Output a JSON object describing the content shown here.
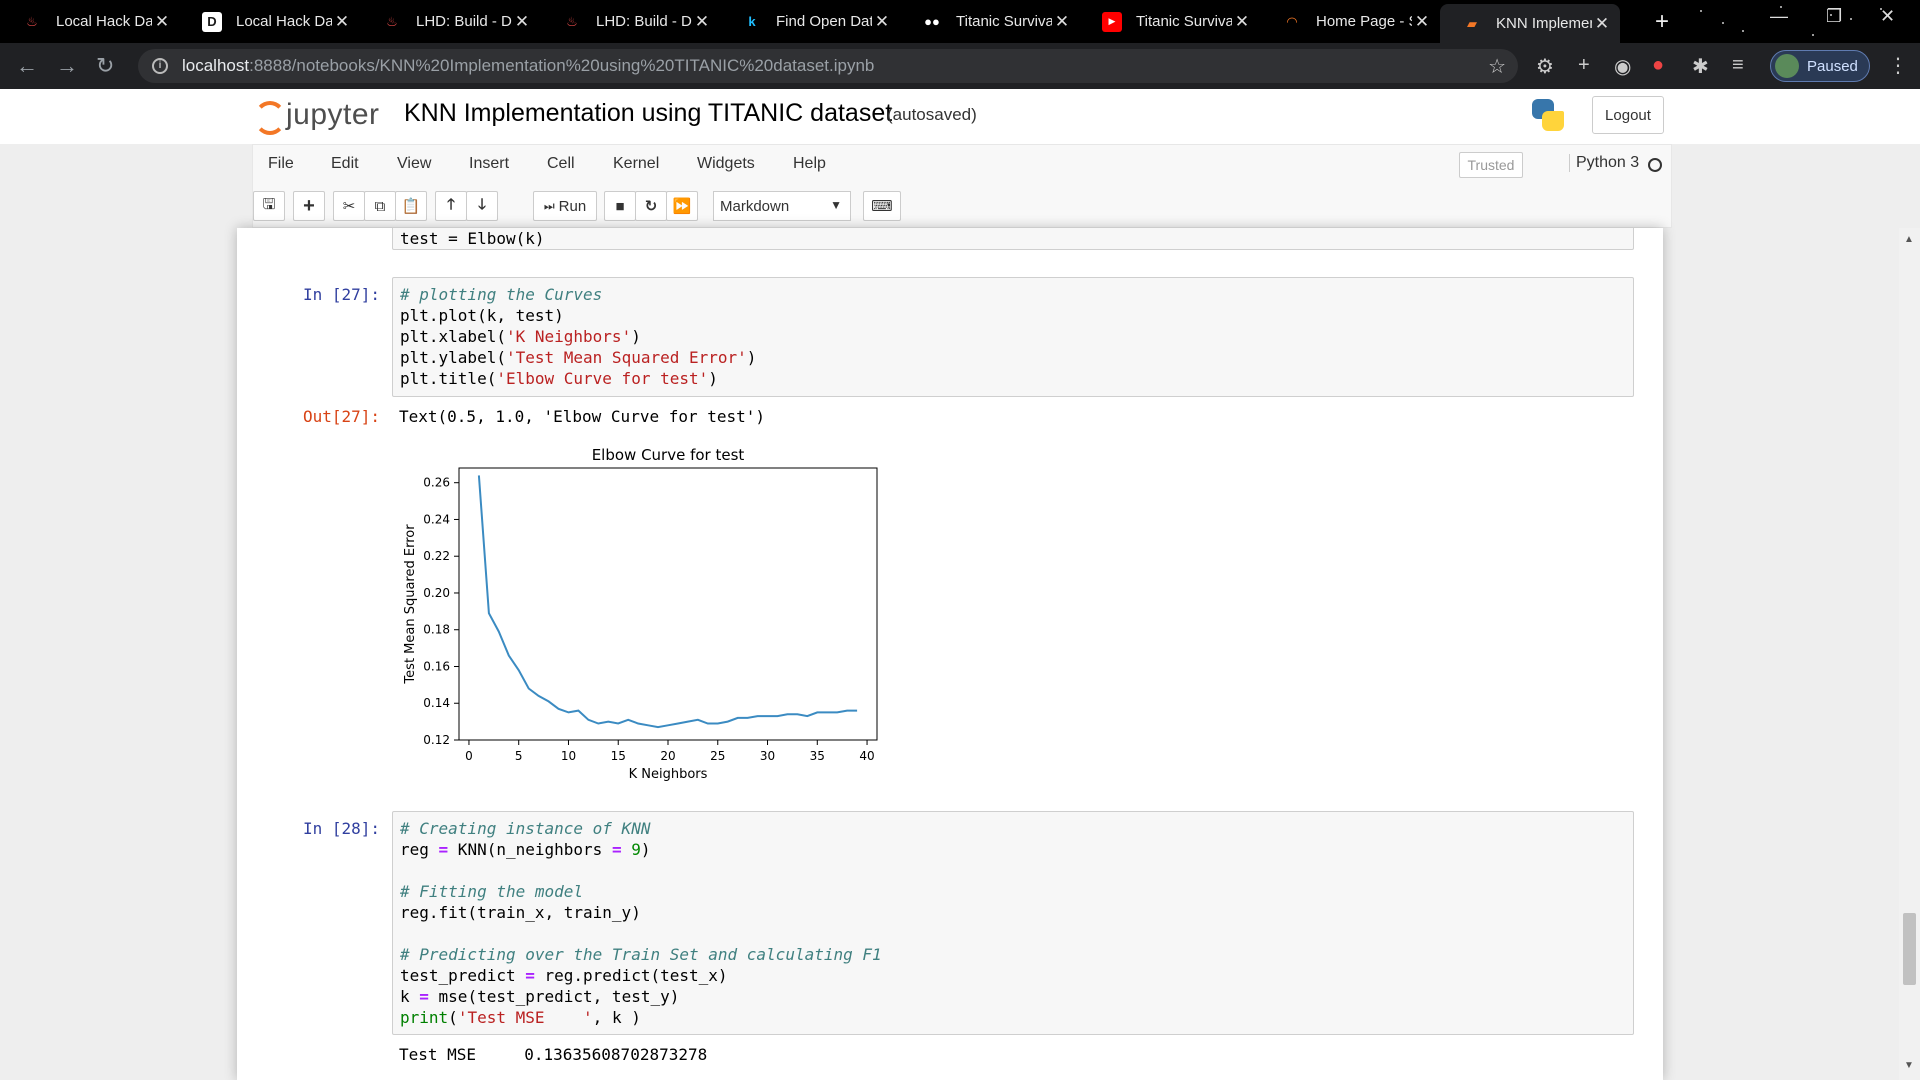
{
  "browser": {
    "tabs": [
      {
        "label": "Local Hack Day",
        "favicon": "lhd-flame-icon",
        "color": "#e34a4a"
      },
      {
        "label": "Local Hack Day",
        "favicon": "devpost-d-icon",
        "color": "#1a1a1a"
      },
      {
        "label": "LHD: Build - Da",
        "favicon": "lhd-flame-icon",
        "color": "#e34a4a"
      },
      {
        "label": "LHD: Build - Da",
        "favicon": "lhd-flame-icon",
        "color": "#e34a4a"
      },
      {
        "label": "Find Open Data",
        "favicon": "kaggle-k-icon",
        "color": "#20beff"
      },
      {
        "label": "Titanic Survival",
        "favicon": "medium-icon",
        "color": "#ffffff"
      },
      {
        "label": "Titanic Survival",
        "favicon": "youtube-icon",
        "color": "#ff0000"
      },
      {
        "label": "Home Page - S",
        "favicon": "jupyter-icon",
        "color": "#f37726"
      },
      {
        "label": "KNN Implemen",
        "favicon": "notebook-icon",
        "color": "#f37726"
      }
    ],
    "url_host": "localhost",
    "url_path": ":8888/notebooks/KNN%20Implementation%20using%20TITANIC%20dataset.ipynb",
    "profile_label": "Paused"
  },
  "jupyter": {
    "logo_text": "jupyter",
    "notebook_title": "KNN Implementation using TITANIC dataset",
    "autosave": "(autosaved)",
    "logout": "Logout",
    "menu": [
      "File",
      "Edit",
      "View",
      "Insert",
      "Cell",
      "Kernel",
      "Widgets",
      "Help"
    ],
    "trusted": "Trusted",
    "kernel_name": "Python 3",
    "toolbar": {
      "run_label": "Run",
      "cell_type": "Markdown"
    }
  },
  "cells": {
    "prev_tail": "test = Elbow(k)",
    "c27_prompt": "In [27]:",
    "c27_lines": [
      {
        "cm": "# plotting the Curves"
      },
      {
        "pre": "plt.plot(k, test)"
      },
      {
        "pre": "plt.xlabel(",
        "st": "'K Neighbors'",
        "post": ")"
      },
      {
        "pre": "plt.ylabel(",
        "st": "'Test Mean Squared Error'",
        "post": ")"
      },
      {
        "pre": "plt.title(",
        "st": "'Elbow Curve for test'",
        "post": ")"
      }
    ],
    "out27_prompt": "Out[27]:",
    "out27_text": "Text(0.5, 1.0, 'Elbow Curve for test')",
    "c28_prompt": "In [28]:",
    "c28": {
      "l1": "# Creating instance of KNN",
      "l2_pre": "reg ",
      "l2_op": "=",
      "l2_mid": " KNN(n_neighbors ",
      "l2_op2": "=",
      "l2_num": " 9",
      "l2_post": ")",
      "l3": "# Fitting the model",
      "l4": "reg.fit(train_x, train_y)",
      "l5": "# Predicting over the Train Set and calculating F1",
      "l6_pre": "test_predict ",
      "l6_op": "=",
      "l6_post": " reg.predict(test_x)",
      "l7_pre": "k ",
      "l7_op": "=",
      "l7_post": " mse(test_predict, test_y)",
      "l8_fn": "print",
      "l8_a": "(",
      "l8_st": "'Test MSE    '",
      "l8_post": ", k )"
    },
    "out28_text": "Test MSE     0.13635608702873278"
  },
  "chart_data": {
    "type": "line",
    "title": "Elbow Curve for test",
    "xlabel": "K Neighbors",
    "ylabel": "Test Mean Squared Error",
    "xlim": [
      -1,
      41
    ],
    "ylim": [
      0.12,
      0.268
    ],
    "xticks": [
      0,
      5,
      10,
      15,
      20,
      25,
      30,
      35,
      40
    ],
    "yticks": [
      0.12,
      0.14,
      0.16,
      0.18,
      0.2,
      0.22,
      0.24,
      0.26
    ],
    "ytick_labels": [
      "0.12",
      "0.14",
      "0.16",
      "0.18",
      "0.20",
      "0.22",
      "0.24",
      "0.26"
    ],
    "line_color": "#3b8bc2",
    "grid": false,
    "x": [
      1,
      2,
      3,
      4,
      5,
      6,
      7,
      8,
      9,
      10,
      11,
      12,
      13,
      14,
      15,
      16,
      17,
      18,
      19,
      20,
      21,
      22,
      23,
      24,
      25,
      26,
      27,
      28,
      29,
      30,
      31,
      32,
      33,
      34,
      35,
      36,
      37,
      38,
      39
    ],
    "y": [
      0.264,
      0.189,
      0.179,
      0.166,
      0.158,
      0.148,
      0.144,
      0.141,
      0.137,
      0.135,
      0.136,
      0.131,
      0.129,
      0.13,
      0.129,
      0.131,
      0.129,
      0.128,
      0.127,
      0.128,
      0.129,
      0.13,
      0.131,
      0.129,
      0.129,
      0.13,
      0.132,
      0.132,
      0.133,
      0.133,
      0.133,
      0.134,
      0.134,
      0.133,
      0.135,
      0.135,
      0.135,
      0.136,
      0.136
    ]
  }
}
